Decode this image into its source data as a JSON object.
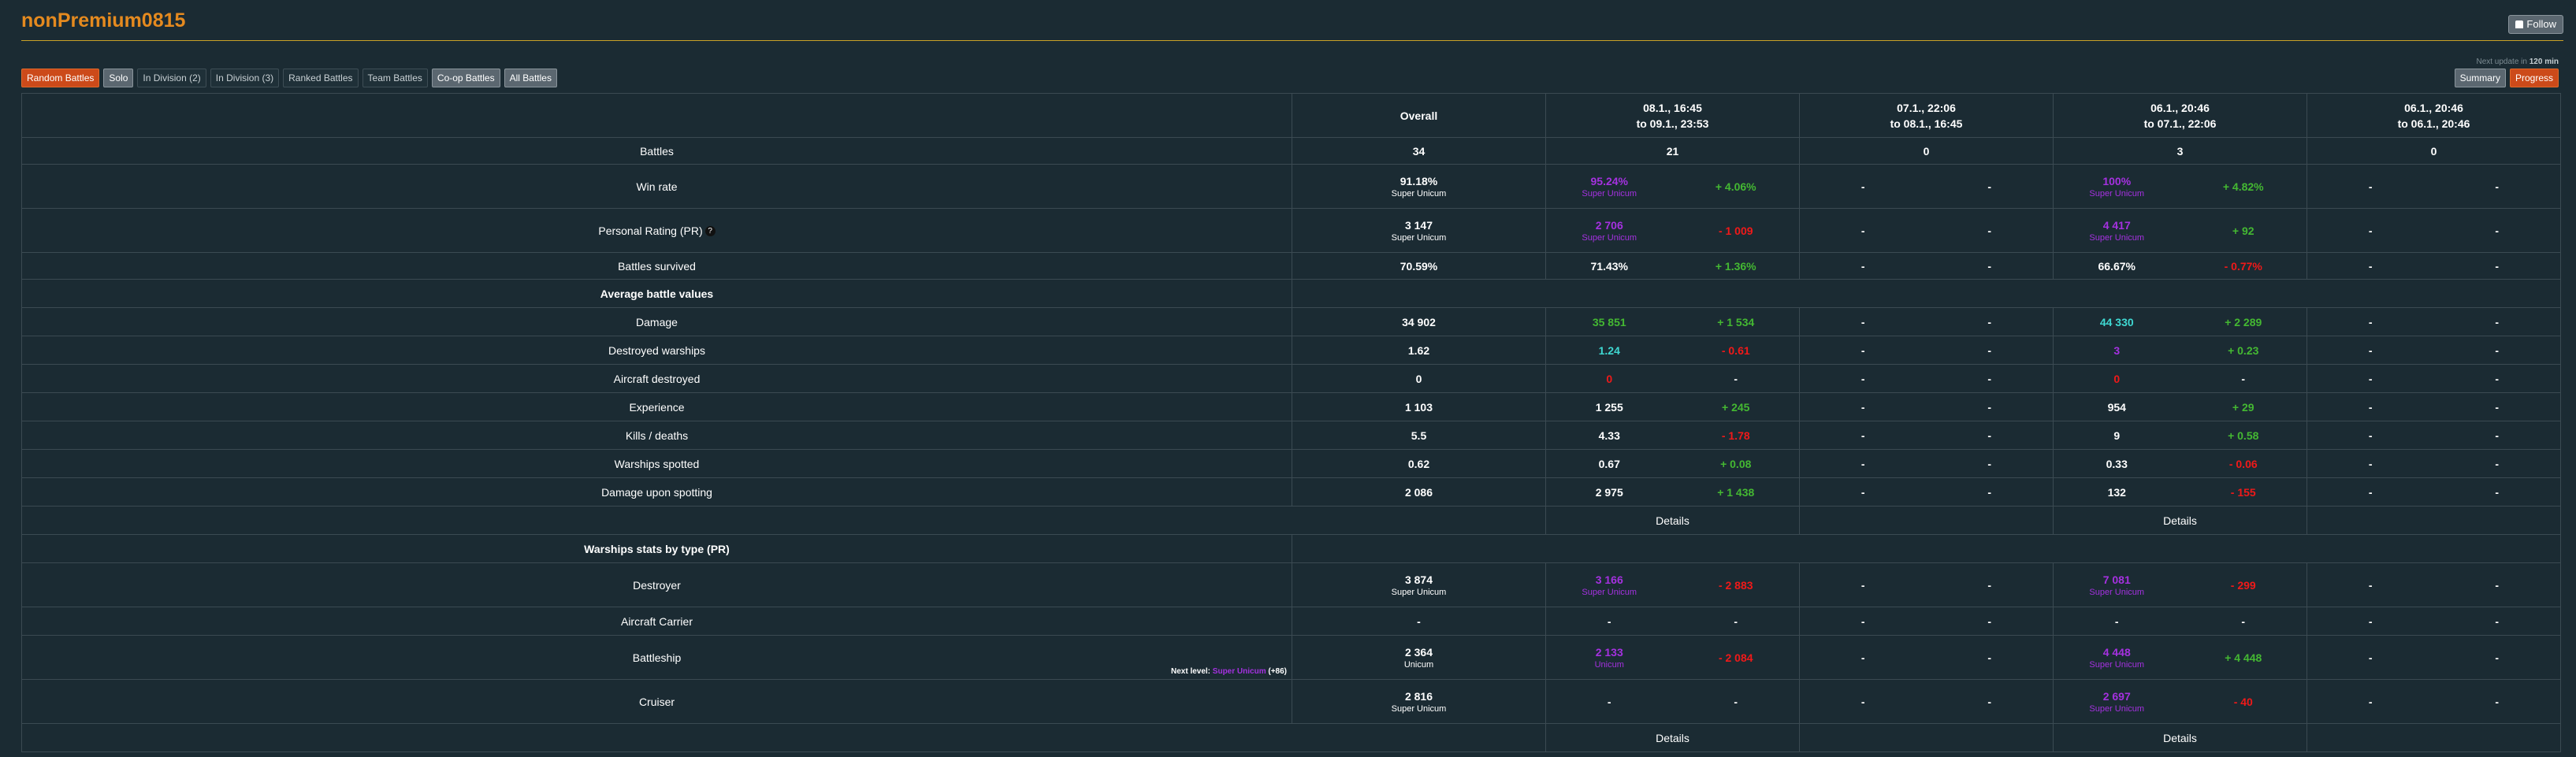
{
  "page": {
    "title": "nonPremium0815",
    "follow_label": "Follow",
    "next_update_prefix": "Next update in",
    "next_update_value": "120 min"
  },
  "filters": [
    "Random Battles",
    "Solo",
    "In Division (2)",
    "In Division (3)",
    "Ranked Battles",
    "Team Battles",
    "Co-op Battles",
    "All Battles"
  ],
  "right_tabs": [
    "Summary",
    "Progress"
  ],
  "columns": {
    "overall": "Overall",
    "p1_line1": "08.1., 16:45",
    "p1_line2": "to 09.1., 23:53",
    "p2_line1": "07.1., 22:06",
    "p2_line2": "to 08.1., 16:45",
    "p3_line1": "06.1., 20:46",
    "p3_line2": "to 07.1., 22:06",
    "p4_line1": "06.1., 20:46",
    "p4_line2": "to 06.1., 20:46"
  },
  "labels": {
    "battles": "Battles",
    "winrate": "Win rate",
    "pr": "Personal Rating (PR)",
    "survived": "Battles survived",
    "avg": "Average battle values",
    "damage": "Damage",
    "destroyed": "Destroyed warships",
    "aircraft": "Aircraft destroyed",
    "xp": "Experience",
    "kd": "Kills / deaths",
    "spotted": "Warships spotted",
    "dmgspot": "Damage upon spotting",
    "types": "Warships stats by type (PR)",
    "dd": "Destroyer",
    "cv": "Aircraft Carrier",
    "bb": "Battleship",
    "ca": "Cruiser",
    "details": "Details",
    "dash": "-",
    "next_level_prefix": "Next level:",
    "next_level_name": "Super Unicum",
    "next_level_delta": "(+86)"
  },
  "rows": {
    "battles": {
      "overall": "34",
      "p1": "21",
      "p2": "0",
      "p3": "3",
      "p4": "0"
    },
    "winrate": {
      "overall": "91.18%",
      "overall_sub": "Super Unicum",
      "p1": "95.24%",
      "p1_sub": "Super Unicum",
      "p1_delta": "+ 4.06%",
      "p3": "100%",
      "p3_sub": "Super Unicum",
      "p3_delta": "+ 4.82%"
    },
    "pr": {
      "overall": "3 147",
      "overall_sub": "Super Unicum",
      "p1": "2 706",
      "p1_sub": "Super Unicum",
      "p1_delta": "- 1 009",
      "p3": "4 417",
      "p3_sub": "Super Unicum",
      "p3_delta": "+ 92"
    },
    "survived": {
      "overall": "70.59%",
      "p1": "71.43%",
      "p1_delta": "+ 1.36%",
      "p3": "66.67%",
      "p3_delta": "- 0.77%"
    },
    "damage": {
      "overall": "34 902",
      "p1": "35 851",
      "p1_delta": "+ 1 534",
      "p3": "44 330",
      "p3_delta": "+ 2 289"
    },
    "destroyed": {
      "overall": "1.62",
      "p1": "1.24",
      "p1_delta": "- 0.61",
      "p3": "3",
      "p3_delta": "+ 0.23"
    },
    "aircraft": {
      "overall": "0",
      "p1": "0",
      "p1_delta": "-",
      "p3": "0",
      "p3_delta": "-"
    },
    "xp": {
      "overall": "1 103",
      "p1": "1 255",
      "p1_delta": "+ 245",
      "p3": "954",
      "p3_delta": "+ 29"
    },
    "kd": {
      "overall": "5.5",
      "p1": "4.33",
      "p1_delta": "- 1.78",
      "p3": "9",
      "p3_delta": "+ 0.58"
    },
    "spotted": {
      "overall": "0.62",
      "p1": "0.67",
      "p1_delta": "+ 0.08",
      "p3": "0.33",
      "p3_delta": "- 0.06"
    },
    "dmgspot": {
      "overall": "2 086",
      "p1": "2 975",
      "p1_delta": "+ 1 438",
      "p3": "132",
      "p3_delta": "- 155"
    },
    "dd": {
      "overall": "3 874",
      "overall_sub": "Super Unicum",
      "p1": "3 166",
      "p1_sub": "Super Unicum",
      "p1_delta": "- 2 883",
      "p3": "7 081",
      "p3_sub": "Super Unicum",
      "p3_delta": "- 299"
    },
    "cv": {
      "overall": "-",
      "p1": "-",
      "p1_delta": "-",
      "p3": "-",
      "p3_delta": "-"
    },
    "bb": {
      "overall": "2 364",
      "overall_sub": "Unicum",
      "p1": "2 133",
      "p1_sub": "Unicum",
      "p1_delta": "- 2 084",
      "p3": "4 448",
      "p3_sub": "Super Unicum",
      "p3_delta": "+ 4 448"
    },
    "ca": {
      "overall": "2 816",
      "overall_sub": "Super Unicum",
      "p1": "-",
      "p1_delta": "-",
      "p3": "2 697",
      "p3_sub": "Super Unicum",
      "p3_delta": "- 40"
    }
  }
}
